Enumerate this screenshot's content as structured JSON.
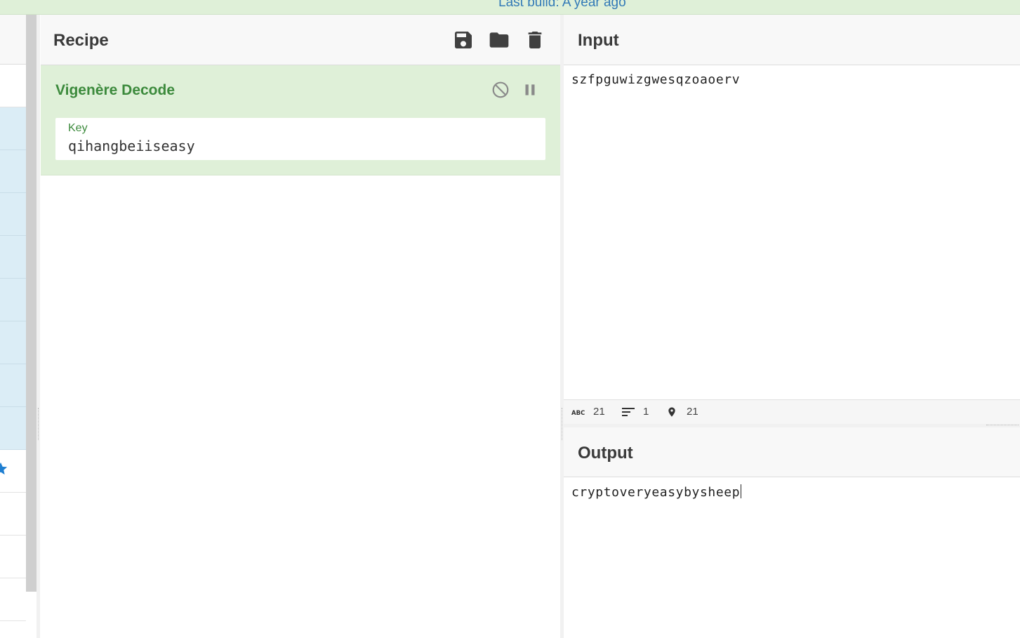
{
  "banner": {
    "text": "Last build: A year ago"
  },
  "recipe": {
    "title": "Recipe",
    "actions": [
      {
        "name": "save-recipe-button",
        "icon": "save-icon"
      },
      {
        "name": "load-recipe-button",
        "icon": "folder-icon"
      },
      {
        "name": "clear-recipe-button",
        "icon": "trash-icon"
      }
    ],
    "operation": {
      "name": "Vigenère Decode",
      "controls": {
        "disable_icon": "disable-icon",
        "breakpoint_icon": "pause-icon"
      },
      "args": [
        {
          "label": "Key",
          "value": "qihangbeiiseasy"
        }
      ]
    }
  },
  "input": {
    "title": "Input",
    "text": "szfpguwizgwesqzoaoerv",
    "status": {
      "length_icon": "abc-icon",
      "length": "21",
      "lines_icon": "lines-icon",
      "lines": "1",
      "position_icon": "location-pin-icon",
      "position": "21"
    }
  },
  "output": {
    "title": "Output",
    "text": "cryptoveryeasybysheep"
  },
  "colors": {
    "banner_bg": "#dff0d8",
    "banner_text": "#337ab7",
    "operation_bg": "#dff0d8",
    "operation_text": "#3c8a3c",
    "favourite_bg": "#dbedf6",
    "star": "#1f7fd1"
  }
}
